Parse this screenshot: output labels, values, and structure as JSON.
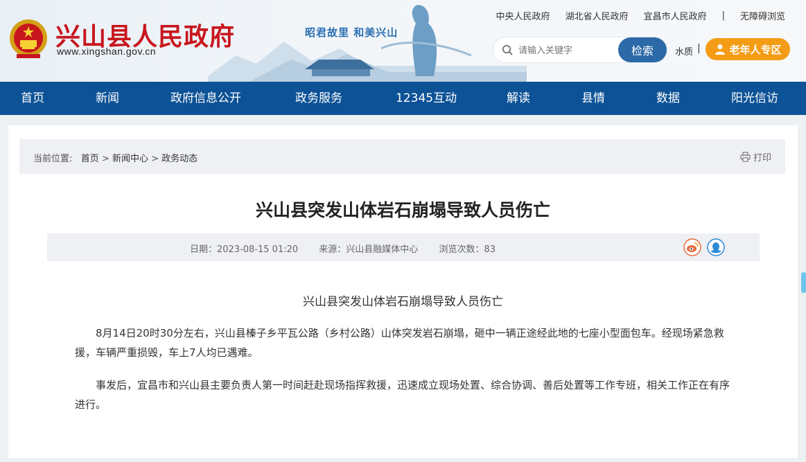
{
  "header": {
    "site_title": "兴山县人民政府",
    "site_url": "www.xingshan.gov.cn",
    "slogan": "昭君故里  和美兴山",
    "top_links": [
      "中央人民政府",
      "湖北省人民政府",
      "宜昌市人民政府",
      "无障碍浏览"
    ],
    "search_placeholder": "请输入关键字",
    "search_button": "检索",
    "water_quality": "水质",
    "elder_zone": "老年人专区"
  },
  "nav": [
    "首页",
    "新闻",
    "政府信息公开",
    "政务服务",
    "12345互动",
    "解读",
    "县情",
    "数据",
    "阳光信访"
  ],
  "breadcrumb": {
    "prefix": "当前位置:",
    "items": [
      "首页",
      "新闻中心",
      "政务动态"
    ],
    "print_label": "打印"
  },
  "article": {
    "title": "兴山县突发山体岩石崩塌导致人员伤亡",
    "date": "日期：2023-08-15 01:20",
    "source": "来源：兴山县融媒体中心",
    "views": "浏览次数：83",
    "sub_title": "兴山县突发山体岩石崩塌导致人员伤亡",
    "paragraphs": [
      "8月14日20时30分左右，兴山县榛子乡平瓦公路（乡村公路）山体突发岩石崩塌，砸中一辆正途经此地的七座小型面包车。经现场紧急救援，车辆严重损毁，车上7人均已遇难。",
      "事发后，宜昌市和兴山县主要负责人第一时间赶赴现场指挥救援，迅速成立现场处置、综合协调、善后处置等工作专班，相关工作正在有序进行。"
    ]
  },
  "colors": {
    "nav_bg": "#0d5296",
    "title_red": "#c8161d",
    "search_btn": "#2b69a8",
    "elder_orange": "#f49c15"
  },
  "icons": [
    "national-emblem-icon",
    "search-icon",
    "elder-user-icon",
    "print-icon",
    "weibo-icon",
    "qq-icon"
  ]
}
